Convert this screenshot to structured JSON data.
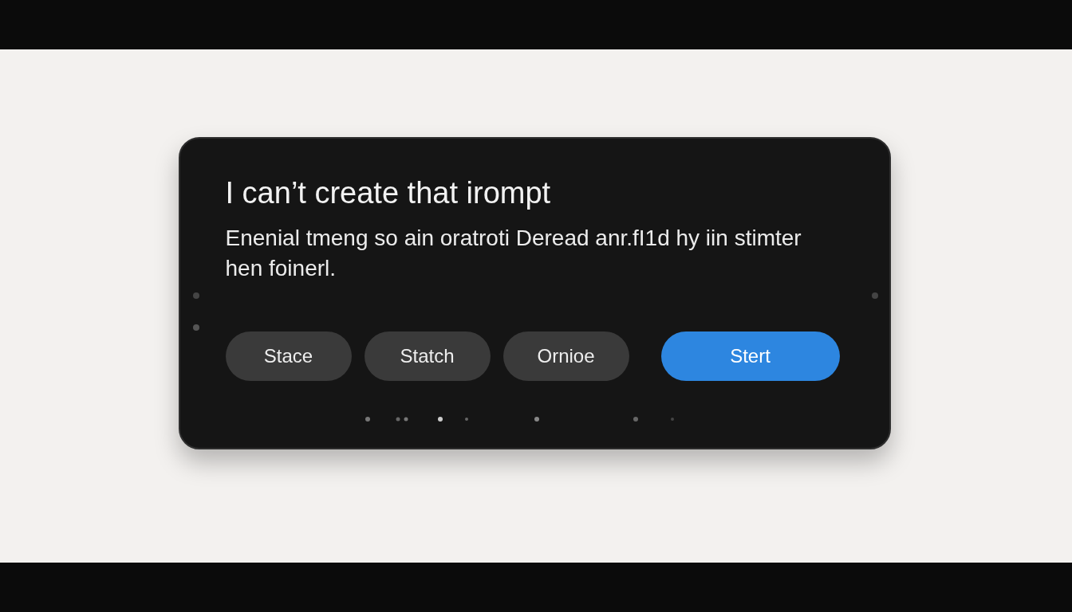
{
  "dialog": {
    "title": "I can’t create that irompt",
    "message": "Enenial tmeng so ain oratroti Deread anr.fI1d hy iin stimter hen foinerl.",
    "buttons": [
      {
        "label": "Stace",
        "kind": "secondary"
      },
      {
        "label": "Statch",
        "kind": "secondary"
      },
      {
        "label": "Ornioe",
        "kind": "secondary"
      },
      {
        "label": "Stert",
        "kind": "primary"
      }
    ]
  }
}
